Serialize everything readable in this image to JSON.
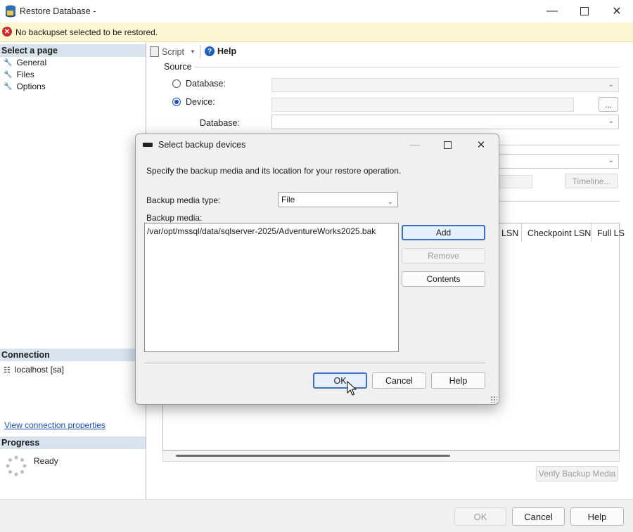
{
  "window": {
    "title": "Restore Database -",
    "error_message": "No backupset selected to be restored."
  },
  "left_pane": {
    "select_page_header": "Select a page",
    "pages": [
      "General",
      "Files",
      "Options"
    ],
    "connection_header": "Connection",
    "connection_server": "localhost [sa]",
    "view_connection_link": "View connection properties",
    "progress_header": "Progress",
    "progress_status": "Ready"
  },
  "toolbar": {
    "script_label": "Script",
    "help_label": "Help"
  },
  "source": {
    "group_label": "Source",
    "database_option": "Database:",
    "device_option": "Device:",
    "selected_option": "Device",
    "browse_button": "...",
    "device_database_label": "Database:"
  },
  "background_controls": {
    "timeline_button": "Timeline...",
    "grid_columns": [
      "LSN",
      "Checkpoint LSN",
      "Full LS"
    ],
    "verify_button": "Verify Backup Media"
  },
  "footer": {
    "ok": "OK",
    "cancel": "Cancel",
    "help": "Help"
  },
  "dialog": {
    "title": "Select backup devices",
    "instructions": "Specify the backup media and its location for your restore operation.",
    "media_type_label": "Backup media type:",
    "media_type_value": "File",
    "media_label": "Backup media:",
    "media_items": [
      "/var/opt/mssql/data/sqlserver-2025/AdventureWorks2025.bak"
    ],
    "add_button": "Add",
    "remove_button": "Remove",
    "contents_button": "Contents",
    "ok_button": "OK",
    "cancel_button": "Cancel",
    "help_button": "Help"
  },
  "colors": {
    "error_bar": "#fdf6d3",
    "section_header": "#d8e3ee",
    "link": "#1a4fb5",
    "primary_border": "#3a6fc4"
  }
}
